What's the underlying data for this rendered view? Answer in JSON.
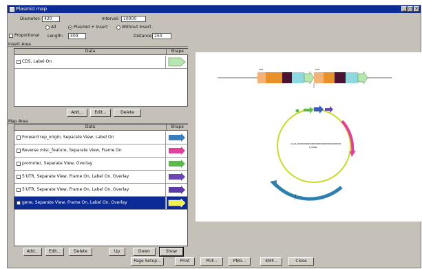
{
  "window": {
    "title": "Plasmid map"
  },
  "settings": {
    "diameter_label": "Diameter:",
    "diameter_value": "420",
    "interval_label": "Interval:",
    "interval_value": "10000",
    "radio_all": "All",
    "radio_plasmid_insert": "Plasmid + Insert",
    "radio_without_insert": "Without Insert",
    "proportional_label": "Proportional",
    "length_label": "Length:",
    "length_value": "400",
    "distance_label": "Distance:",
    "distance_value": "250"
  },
  "insert_area": {
    "title": "Insert Area",
    "col_data": "Data",
    "col_shape": "Shape",
    "rows": [
      {
        "label": "CDS, Label On",
        "checked": false,
        "color": "#b8e6b0"
      }
    ],
    "buttons": {
      "add": "Add...",
      "edit": "Edit...",
      "delete": "Delete"
    }
  },
  "map_area": {
    "title": "Map Area",
    "col_data": "Data",
    "col_shape": "Shape",
    "rows": [
      {
        "label": "Forward rep_origin, Separate View, Label On",
        "checked": false,
        "color": "#3a7dbb"
      },
      {
        "label": "Reverse misc_feature, Separate View, Frame On",
        "checked": false,
        "color": "#e0409a"
      },
      {
        "label": "promoter, Separate View, Overlay",
        "checked": false,
        "color": "#5ab94a"
      },
      {
        "label": "5'UTR, Separate View, Frame On, Label On, Overlay",
        "checked": false,
        "color": "#6a48b4"
      },
      {
        "label": "5'UTR, Separate View, Frame On, Label On, Overlay",
        "checked": false,
        "color": "#5c3aa8"
      },
      {
        "label": "gene, Separate View, Frame On, Label On, Overlay",
        "checked": true,
        "color": "#f2f04a"
      }
    ],
    "buttons": {
      "add": "Add...",
      "edit": "Edit...",
      "delete": "Delete",
      "up": "Up",
      "down": "Down",
      "show": "Show"
    }
  },
  "bottom_buttons": {
    "page_setup": "Page Setup...",
    "print": "Print",
    "pdf": "PDF...",
    "png": "PNG...",
    "emf": "EMF...",
    "close": "Close"
  },
  "preview": {
    "top_label_1": "CDS",
    "top_label_2": "CDS",
    "center_text_1": "Insert_000000000000000000000000000000000000",
    "center_text_2": "0_000bp",
    "circle_color": "#c9d92a"
  }
}
